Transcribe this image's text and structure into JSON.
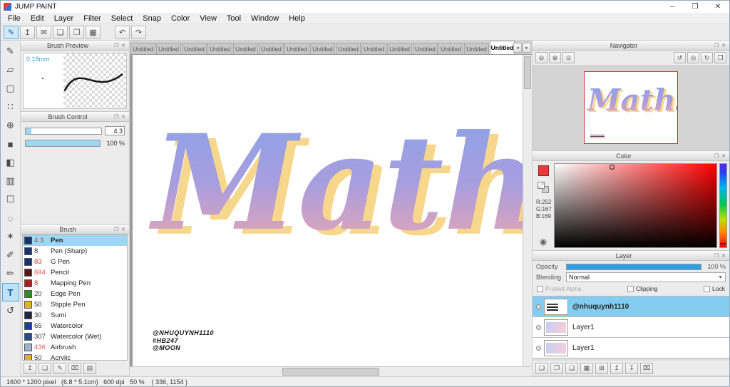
{
  "titlebar": {
    "title": "JUMP PAINT",
    "minimize": "–",
    "maximize": "❐",
    "close": "✕"
  },
  "menu": {
    "items": [
      "File",
      "Edit",
      "Layer",
      "Filter",
      "Select",
      "Snap",
      "Color",
      "View",
      "Tool",
      "Window",
      "Help"
    ]
  },
  "toolbar": {
    "icons": [
      {
        "name": "paint-brush-icon",
        "glyph": "✎",
        "active": true
      },
      {
        "name": "publish-icon",
        "glyph": "↥"
      },
      {
        "name": "comment-icon",
        "glyph": "✉"
      },
      {
        "name": "storyboard-icon",
        "glyph": "❑"
      },
      {
        "name": "pages-icon",
        "glyph": "❐"
      },
      {
        "name": "material-panel-icon",
        "glyph": "▦"
      }
    ],
    "undo_glyph": "↶",
    "redo_glyph": "↷"
  },
  "panel_icons": {
    "float": "❐",
    "close": "✕"
  },
  "tools": {
    "items": [
      {
        "name": "pen-tool",
        "glyph": "✎"
      },
      {
        "name": "eraser-tool",
        "glyph": "▱"
      },
      {
        "name": "stamp-tool",
        "glyph": "▢"
      },
      {
        "name": "dot-tool",
        "glyph": "∷"
      },
      {
        "name": "move-tool",
        "glyph": "⊕"
      },
      {
        "name": "fill-rect-tool",
        "glyph": "■"
      },
      {
        "name": "bucket-tool",
        "glyph": "◧"
      },
      {
        "name": "gradient-tool",
        "glyph": "▥"
      },
      {
        "name": "select-tool",
        "glyph": "☐"
      },
      {
        "name": "lasso-tool",
        "glyph": "◌"
      },
      {
        "name": "magic-wand-tool",
        "glyph": "✶"
      },
      {
        "name": "pen-edit-tool",
        "glyph": "✐"
      },
      {
        "name": "control-point-tool",
        "glyph": "✏"
      },
      {
        "name": "text-tool",
        "glyph": "T",
        "active": true
      },
      {
        "name": "rotate-view-tool",
        "glyph": "↺"
      }
    ]
  },
  "brush_preview": {
    "title": "Brush Preview",
    "size_label": "0.18mm"
  },
  "brush_control": {
    "title": "Brush Control",
    "size_value": "4.3",
    "size_fill_pct": 8,
    "opacity_value": "100 %",
    "opacity_fill_pct": 100
  },
  "brush_panel": {
    "title": "Brush",
    "items": [
      {
        "size": "4.3",
        "name": "Pen",
        "swatch": "#16336e",
        "size_color": "#c0392b",
        "selected": true
      },
      {
        "size": "8",
        "name": "Pen (Sharp)",
        "swatch": "#16336e",
        "size_color": "#333333"
      },
      {
        "size": "83",
        "name": "G Pen",
        "swatch": "#16336e",
        "size_color": "#c0392b"
      },
      {
        "size": "694",
        "name": "Pencil",
        "swatch": "#5a1414",
        "size_color": "#e05555"
      },
      {
        "size": "8",
        "name": "Mapping Pen",
        "swatch": "#a32020",
        "size_color": "#c0392b"
      },
      {
        "size": "20",
        "name": "Edge Pen",
        "swatch": "#2e8b2e",
        "size_color": "#333333"
      },
      {
        "size": "50",
        "name": "Stipple Pen",
        "swatch": "#e0b31e",
        "size_color": "#333333"
      },
      {
        "size": "30",
        "name": "Sumi",
        "swatch": "#23233a",
        "size_color": "#333333"
      },
      {
        "size": "65",
        "name": "Watercolor",
        "swatch": "#1c3fa0",
        "size_color": "#333333"
      },
      {
        "size": "307",
        "name": "Watercolor (Wet)",
        "swatch": "#274b86",
        "size_color": "#333333"
      },
      {
        "size": "436",
        "name": "Airbrush",
        "swatch": "#9fb3c8",
        "size_color": "#e05555"
      },
      {
        "size": "50",
        "name": "Acrylic",
        "swatch": "#e0b31e",
        "size_color": "#333333"
      }
    ]
  },
  "brush_actions": [
    {
      "name": "upload-brush-icon",
      "glyph": "↥"
    },
    {
      "name": "add-brush-icon",
      "glyph": "❏"
    },
    {
      "name": "edit-brush-icon",
      "glyph": "✎"
    },
    {
      "name": "delete-brush-icon",
      "glyph": "⌧"
    },
    {
      "name": "brush-menu-icon",
      "glyph": "▤"
    }
  ],
  "tabs": {
    "items": [
      "Untitled",
      "Untitled",
      "Untitled",
      "Untitled",
      "Untitled",
      "Untitled",
      "Untitled",
      "Untitled",
      "Untitled",
      "Untitled",
      "Untitled",
      "Untitled",
      "Untitled",
      "Untitled",
      "Untitled"
    ],
    "active_index": 14,
    "scroll_buttons": [
      {
        "name": "tab-scroll-left-icon",
        "glyph": "◂"
      },
      {
        "name": "tab-scroll-right-icon",
        "glyph": "▸"
      }
    ]
  },
  "canvas": {
    "word": "Maths",
    "credits": [
      "@NHUQUYNH1110",
      "#HB247",
      "@MOON"
    ],
    "gradient_top": "#87a4ea",
    "gradient_mid": "#a89dde",
    "gradient_bottom": "#f3a7ac",
    "shadow_color": "#f7d78c"
  },
  "navigator": {
    "title": "Navigator",
    "icons": [
      {
        "name": "zoom-out-icon",
        "glyph": "⊖"
      },
      {
        "name": "zoom-in-icon",
        "glyph": "⊕"
      },
      {
        "name": "zoom-reset-icon",
        "glyph": "⊙"
      },
      {
        "spacer": true
      },
      {
        "name": "rotate-ccw-icon",
        "glyph": "↺"
      },
      {
        "name": "reset-rotation-icon",
        "glyph": "◎"
      },
      {
        "name": "rotate-cw-icon",
        "glyph": "↻"
      },
      {
        "name": "fit-window-icon",
        "glyph": "❐"
      }
    ]
  },
  "color_panel": {
    "title": "Color",
    "r": "R:252",
    "g": "G:167",
    "b": "B:169",
    "current_swatch": "#e8393d",
    "current_rgb": "#fca7a9"
  },
  "layer_panel": {
    "title": "Layer",
    "opacity_label": "Opacity",
    "opacity_value": "100 %",
    "opacity_fill_pct": 100,
    "blending_label": "Blending",
    "blending_value": "Normal",
    "blending_arrow": "▼",
    "protect_alpha_label": "Protect Alpha",
    "clipping_label": "Clipping",
    "lock_label": "Lock",
    "layers": [
      {
        "name": "@nhuquynh1110",
        "selected": true,
        "thumb": "credits"
      },
      {
        "name": "Layer1",
        "thumb": "art"
      },
      {
        "name": "Layer1",
        "thumb": "art"
      }
    ],
    "actions": [
      {
        "name": "add-layer-icon",
        "glyph": "❏"
      },
      {
        "name": "duplicate-layer-icon",
        "glyph": "❐"
      },
      {
        "name": "transfer-layer-icon",
        "glyph": "❑"
      },
      {
        "name": "material-layer-icon",
        "glyph": "▦"
      },
      {
        "name": "folder-layer-icon",
        "glyph": "⊞"
      },
      {
        "name": "layer-up-icon",
        "glyph": "↥"
      },
      {
        "name": "layer-down-icon",
        "glyph": "↧"
      },
      {
        "name": "delete-layer-icon",
        "glyph": "⌧"
      }
    ]
  },
  "status_bar": {
    "text": "1600 * 1200 pixel   (6.8 * 5.1cm)   600 dpi   50 %    ( 336, 1154 )"
  }
}
